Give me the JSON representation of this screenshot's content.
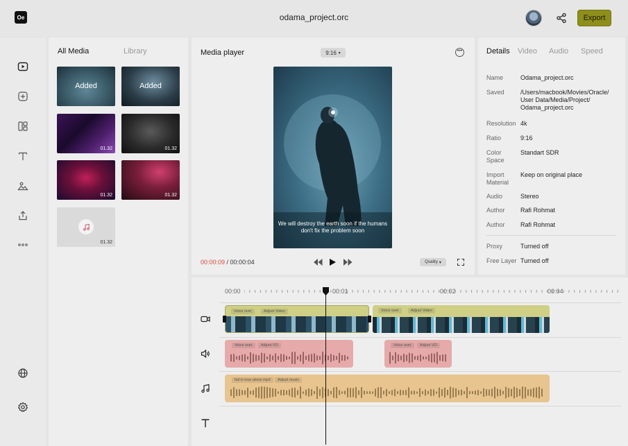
{
  "app": {
    "logo": "Oe",
    "project_title": "odama_project.orc",
    "export_label": "Export",
    "accent": "#8e8e1c"
  },
  "rail": {
    "icons": [
      "play-icon",
      "plus-icon",
      "layout-icon",
      "text-icon",
      "image-icon",
      "upload-icon",
      "more-icon",
      "globe-icon",
      "settings-icon"
    ]
  },
  "media": {
    "tabs": [
      "All Media",
      "Library"
    ],
    "items": [
      {
        "label": "Added",
        "duration": ""
      },
      {
        "label": "Added",
        "duration": ""
      },
      {
        "label": "",
        "duration": "01.32"
      },
      {
        "label": "",
        "duration": "01.32"
      },
      {
        "label": "",
        "duration": "01.32"
      },
      {
        "label": "",
        "duration": "01.32"
      },
      {
        "label": "",
        "duration": "01.32"
      }
    ]
  },
  "player": {
    "title": "Media player",
    "ratio": "9:16",
    "subtitle": "We will destroy the earth soon if the humans don't fix the problem soon",
    "time_current": "00:00:09",
    "time_total": " / 00:00:04",
    "quality_label": "Quality"
  },
  "details": {
    "tabs": [
      "Details",
      "Video",
      "Audio",
      "Speed"
    ],
    "rows": [
      {
        "key": "Name",
        "value": "Odama_project.orc"
      },
      {
        "key": "Saved",
        "value": "/Users/macbook/Movies/Oracle/ User Data/Media/Project/ Odama_project.orc"
      },
      {
        "key": "Resolution",
        "value": "4k"
      },
      {
        "key": "Ratio",
        "value": "9:16"
      },
      {
        "key": "Color Space",
        "value": "Standart SDR"
      },
      {
        "key": "Import Material",
        "value": "Keep on original place"
      },
      {
        "key": "Audio",
        "value": "Stereo"
      },
      {
        "key": "Author",
        "value": "Rafi Rohmat"
      },
      {
        "key": "Author",
        "value": "Rafi Rohmat"
      },
      {
        "key": "Proxy",
        "value": "Turned off"
      },
      {
        "key": "Free Layer",
        "value": "Turned off"
      }
    ]
  },
  "timeline": {
    "ruler": [
      "00:00",
      "00:01",
      "00:02",
      "00:04"
    ],
    "video_clips": [
      {
        "chips": [
          "Voice over",
          "Adjust Video"
        ]
      },
      {
        "chips": [
          "Voice over",
          "Adjust Video"
        ]
      }
    ],
    "audio_clips": [
      {
        "chips": [
          "Voice over",
          "Adjust VO"
        ]
      },
      {
        "chips": [
          "Voice over",
          "Adjust VO"
        ]
      }
    ],
    "music_clip": {
      "chips": [
        "fall in love alone.mp3",
        "Adjust music"
      ]
    },
    "colors": {
      "video": "#cfcf86",
      "audio": "#e6aaaa",
      "music": "#e8c48e"
    }
  }
}
